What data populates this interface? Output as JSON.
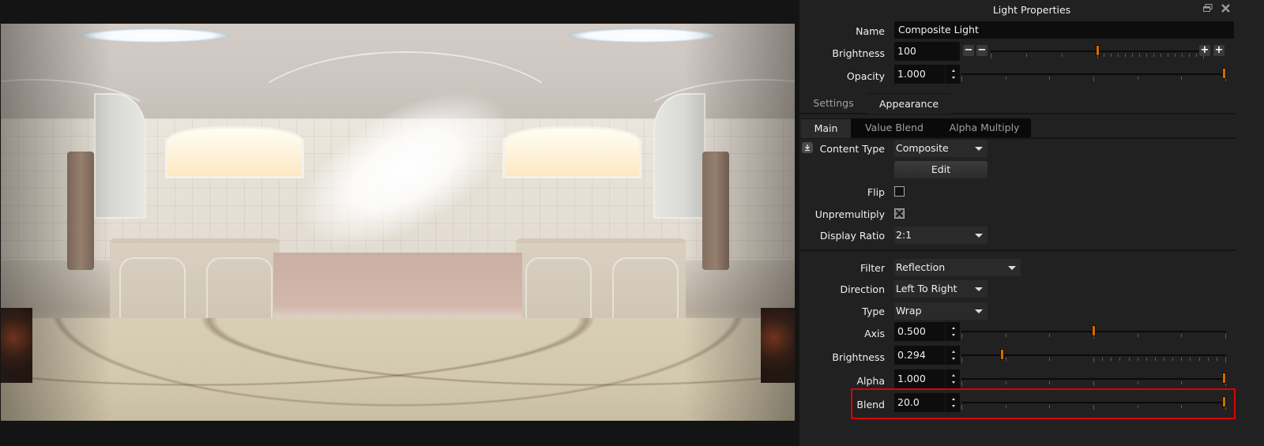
{
  "viewport": {
    "content": "equirectangular panorama of bathroom"
  },
  "panel": {
    "title": "Light Properties",
    "float_icon": "float-window-icon",
    "close_icon": "close-icon",
    "name": {
      "label": "Name",
      "value": "Composite Light"
    },
    "brightness": {
      "label": "Brightness",
      "value": "100",
      "slider_fraction": 0.5,
      "minus_large": "−",
      "minus_small": "−",
      "plus_small": "+",
      "plus_large": "+"
    },
    "opacity": {
      "label": "Opacity",
      "value": "1.000",
      "slider_fraction": 1.0
    },
    "tabs": [
      {
        "label": "Settings",
        "active": false
      },
      {
        "label": "Appearance",
        "active": true
      }
    ],
    "subtabs": [
      {
        "label": "Main",
        "active": true
      },
      {
        "label": "Value Blend",
        "active": false
      },
      {
        "label": "Alpha Multiply",
        "active": false
      }
    ],
    "content_type": {
      "label": "Content Type",
      "value": "Composite",
      "icon": "download-icon"
    },
    "edit_button": "Edit",
    "flip": {
      "label": "Flip",
      "checked": false
    },
    "unpremultiply": {
      "label": "Unpremultiply",
      "checked": true
    },
    "display_ratio": {
      "label": "Display Ratio",
      "value": "2:1"
    },
    "filter": {
      "label": "Filter",
      "value": "Reflection"
    },
    "direction": {
      "label": "Direction",
      "value": "Left To Right"
    },
    "type": {
      "label": "Type",
      "value": "Wrap"
    },
    "axis": {
      "label": "Axis",
      "value": "0.500",
      "slider_fraction": 0.5
    },
    "filter_brightness": {
      "label": "Brightness",
      "value": "0.294",
      "slider_fraction": 0.147
    },
    "alpha": {
      "label": "Alpha",
      "value": "1.000",
      "slider_fraction": 1.0
    },
    "blend": {
      "label": "Blend",
      "value": "20.0",
      "slider_fraction": 1.0,
      "highlighted": true
    },
    "colors": {
      "accent": "#d46a00",
      "highlight": "#e00000",
      "panel_bg": "#212121"
    }
  }
}
